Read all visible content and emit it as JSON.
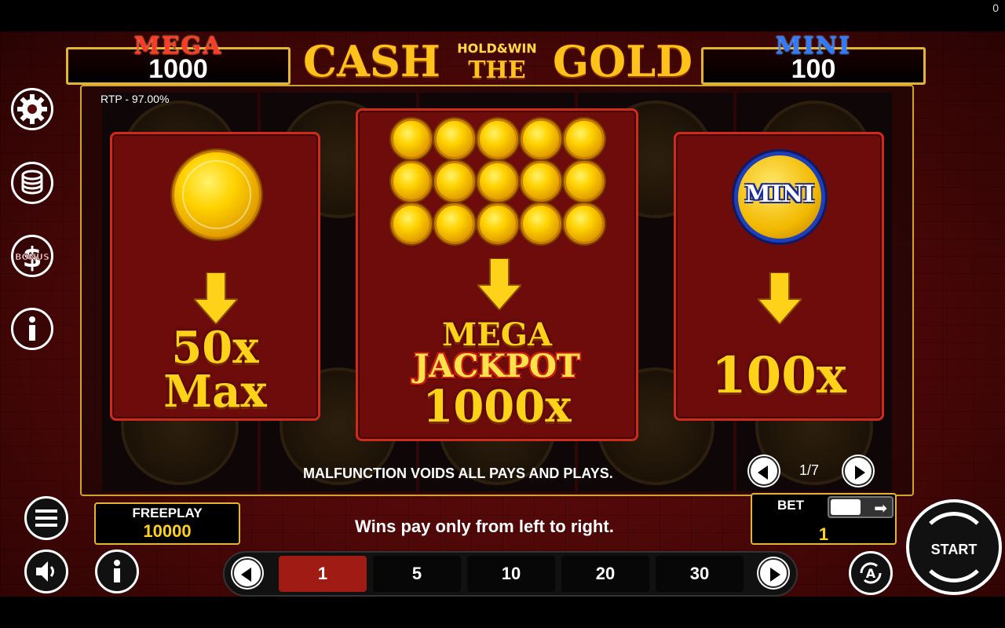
{
  "jackpots": {
    "mega": {
      "title": "MEGA",
      "value": "1000"
    },
    "mini": {
      "title": "MINI",
      "value": "100"
    }
  },
  "logo": {
    "word1": "CASH",
    "tagline": "HOLD&WIN",
    "word2": "THE",
    "word3": "GOLD"
  },
  "corner_counter": "0",
  "rtp": "RTP - 97.00%",
  "paytable": {
    "left": {
      "line1": "50x",
      "line2": "Max"
    },
    "middle": {
      "line1": "MEGA",
      "line2": "JACKPOT",
      "line3": "1000x"
    },
    "right": {
      "coin_label": "MINI",
      "line1": "100x"
    }
  },
  "malfunction_text": "MALFUNCTION VOIDS ALL PAYS AND PLAYS.",
  "page_indicator": "1/7",
  "side_icons": [
    "gear-icon",
    "coins-stack-icon",
    "bonus-icon",
    "info-icon"
  ],
  "bonus_icon_label": "BONUS",
  "freeplay": {
    "label": "FREEPLAY",
    "value": "10000"
  },
  "wins_note": "Wins pay only from left to right.",
  "bet": {
    "label": "BET",
    "value": "1"
  },
  "bet_options": [
    "1",
    "5",
    "10",
    "20",
    "30"
  ],
  "selected_bet_index": 0,
  "start_label": "START",
  "autoplay_label": "A",
  "colors": {
    "gold": "#ffd21a",
    "frame": "#e2b632",
    "panel_red": "#6e0c0c",
    "active_bet": "#9f1b14"
  }
}
